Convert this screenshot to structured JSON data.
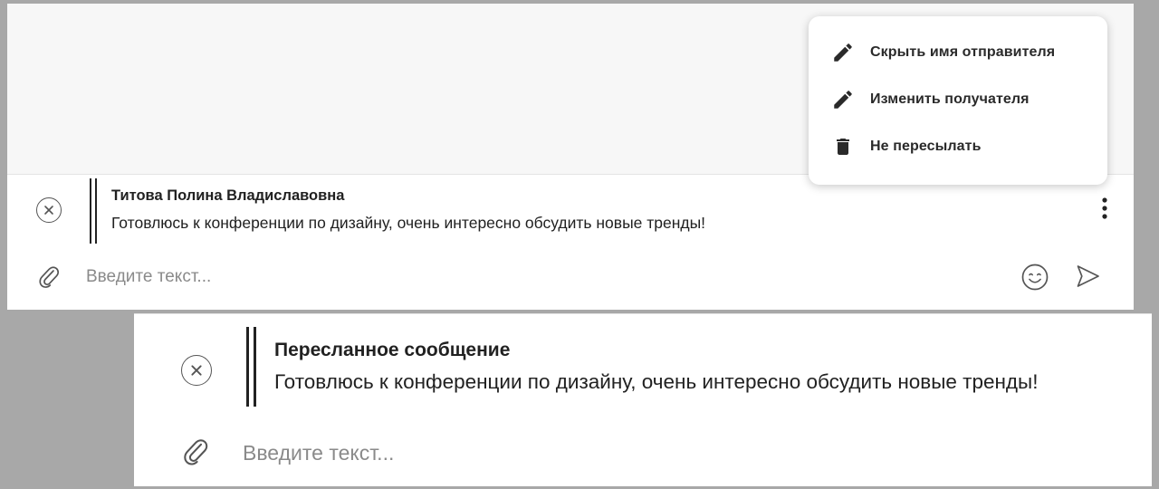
{
  "top_panel": {
    "menu": {
      "items": [
        {
          "label": "Скрыть имя отправителя",
          "icon": "pencil-icon"
        },
        {
          "label": "Изменить получателя",
          "icon": "pencil-icon"
        },
        {
          "label": "Не пересылать",
          "icon": "trash-icon"
        }
      ]
    },
    "forward": {
      "sender": "Титова Полина Владиславовна",
      "text": "Готовлюсь к конференции по дизайну, очень интересно обсудить новые тренды!"
    },
    "input": {
      "placeholder": "Введите текст..."
    }
  },
  "bottom_panel": {
    "forward": {
      "title": "Пересланное сообщение",
      "text": "Готовлюсь к конференции по дизайну, очень интересно обсудить новые тренды!"
    },
    "input": {
      "placeholder": "Введите текст..."
    }
  },
  "colors": {
    "backdrop": "#a8a8a8",
    "chat_background": "#f7f7f7",
    "icon": "#555555",
    "text": "#212121",
    "placeholder": "#8a8a8a"
  }
}
